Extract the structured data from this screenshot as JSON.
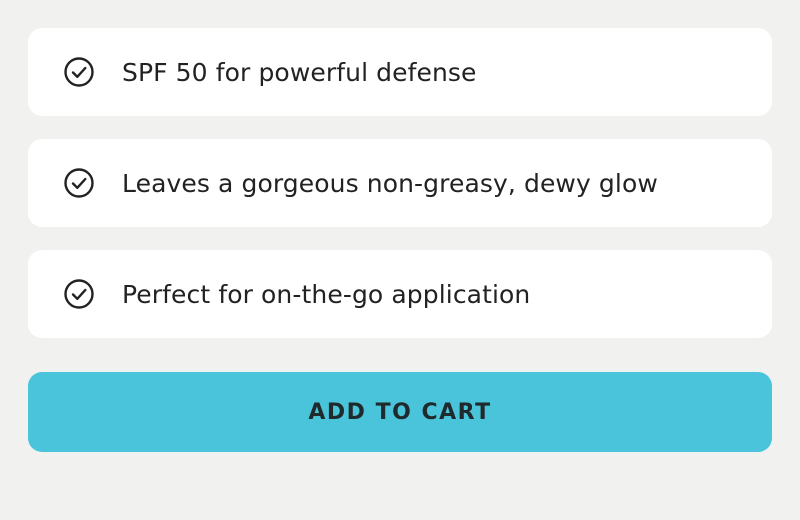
{
  "features": [
    {
      "icon": "check-circle-icon",
      "text": "SPF 50 for powerful defense"
    },
    {
      "icon": "check-circle-icon",
      "text": "Leaves a gorgeous non-greasy, dewy glow"
    },
    {
      "icon": "check-circle-icon",
      "text": "Perfect for on-the-go application"
    }
  ],
  "cart_button": {
    "label": "ADD TO CART"
  },
  "colors": {
    "background": "#f1f1ef",
    "card": "#ffffff",
    "button": "#4ac4da",
    "text": "#222222"
  }
}
